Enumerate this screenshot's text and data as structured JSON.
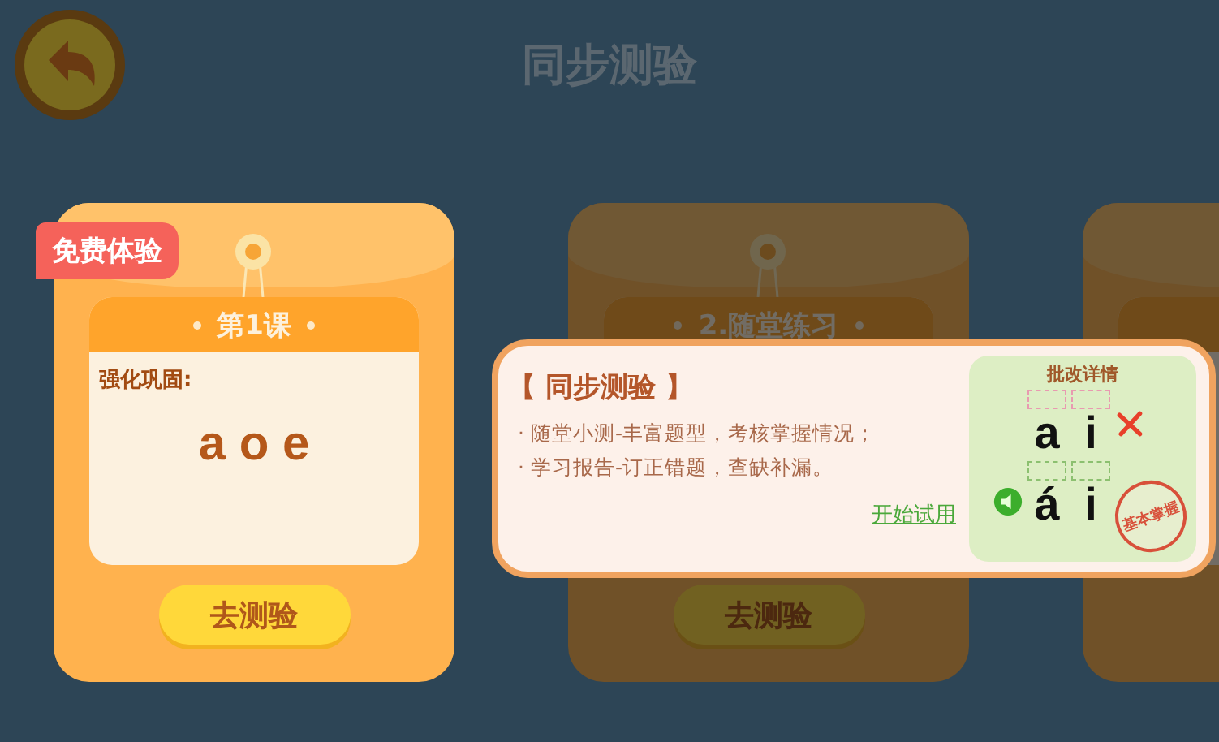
{
  "header": {
    "title": "同步测验"
  },
  "cards": [
    {
      "badge": "免费体验",
      "lesson": "第1课",
      "subtitle": "强化巩固:",
      "letters": "a o e",
      "button": "去测验",
      "dimmed": false
    },
    {
      "lesson": "2.随堂练习",
      "button": "去测验",
      "dimmed": true
    },
    {
      "dimmed": true
    }
  ],
  "tooltip": {
    "title": "【 同步测验 】",
    "lines": [
      "· 随堂小测-丰富题型，考核掌握情况；",
      "· 学习报告-订正错题，查缺补漏。"
    ],
    "link": "开始试用",
    "preview": {
      "heading": "批改详情",
      "stamp": "基本掌握",
      "rows": [
        {
          "letters": [
            "a",
            "i"
          ],
          "correct": false,
          "speaker": false
        },
        {
          "letters": [
            "á",
            "i"
          ],
          "correct": true,
          "speaker": true
        }
      ]
    }
  }
}
